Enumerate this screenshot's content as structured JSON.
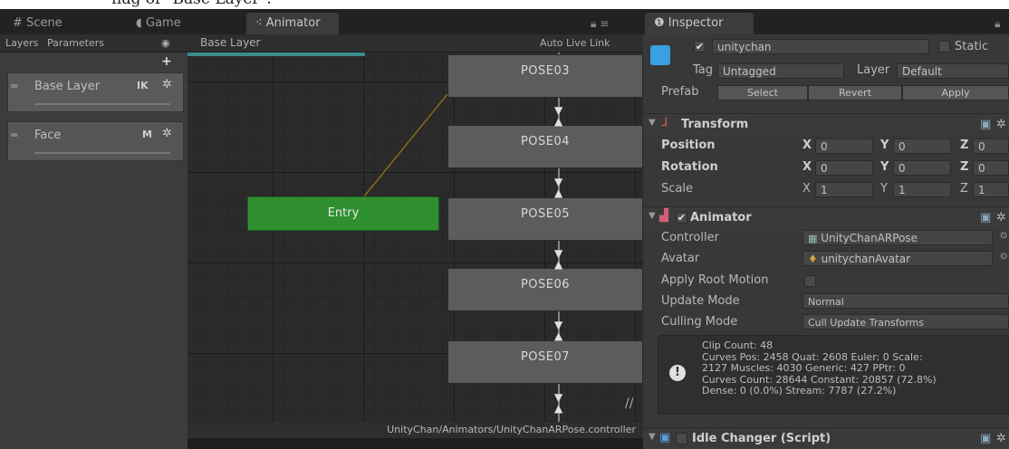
{
  "caption": "flag of \"Base Layer\".",
  "tabs": {
    "scene": "Scene",
    "game": "Game",
    "animator": "Animator",
    "inspector": "Inspector"
  },
  "animator": {
    "layers_tab": "Layers",
    "parameters_tab": "Parameters",
    "breadcrumb": "Base Layer",
    "auto_live_link": "Auto Live Link",
    "add_symbol": "+",
    "layers": [
      {
        "name": "Base Layer",
        "tag": "IK"
      },
      {
        "name": "Face",
        "tag": "M"
      }
    ],
    "states": {
      "entry": "Entry",
      "poses": [
        "POSE03",
        "POSE04",
        "POSE05",
        "POSE06",
        "POSE07"
      ]
    },
    "controller_path": "UnityChan/Animators/UnityChanARPose.controller"
  },
  "inspector": {
    "object_name": "unitychan",
    "static_label": "Static",
    "tag_label": "Tag",
    "tag_value": "Untagged",
    "layer_label": "Layer",
    "layer_value": "Default",
    "prefab_label": "Prefab",
    "prefab_select": "Select",
    "prefab_revert": "Revert",
    "prefab_apply": "Apply",
    "transform": {
      "title": "Transform",
      "position_label": "Position",
      "rotation_label": "Rotation",
      "scale_label": "Scale",
      "axis_x": "X",
      "axis_y": "Y",
      "axis_z": "Z",
      "position": [
        "0",
        "0",
        "0"
      ],
      "rotation": [
        "0",
        "0",
        "0"
      ],
      "scale": [
        "1",
        "1",
        "1"
      ]
    },
    "animator": {
      "title": "Animator",
      "controller_label": "Controller",
      "controller_value": "UnityChanARPose",
      "avatar_label": "Avatar",
      "avatar_value": "unitychanAvatar",
      "apply_root_motion_label": "Apply Root Motion",
      "update_mode_label": "Update Mode",
      "update_mode_value": "Normal",
      "culling_mode_label": "Culling Mode",
      "culling_mode_value": "Cull Update Transforms",
      "info_lines": [
        "Clip Count: 48",
        "Curves Pos: 2458 Quat: 2608 Euler: 0 Scale:",
        "2127 Muscles: 4030 Generic: 427 PPtr: 0",
        "Curves Count: 28644 Constant: 20857 (72.8%)",
        "Dense: 0 (0.0%) Stream: 7787 (27.2%)"
      ]
    },
    "idle_changer": "Idle Changer (Script)"
  },
  "colors": {
    "entry_state": "#2f8f2f",
    "panel_bg": "#383838",
    "graph_bg": "#2b2b2b"
  }
}
